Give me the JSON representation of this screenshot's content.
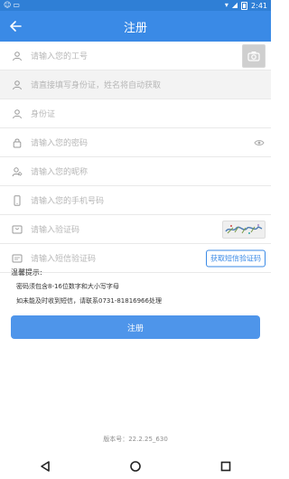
{
  "status_bar": {
    "time": "2:41",
    "left_icons": [
      "android-icon",
      "notification-icon"
    ],
    "right_icons": [
      "wifi-icon",
      "signal-icon",
      "battery-icon"
    ]
  },
  "header": {
    "title": "注册"
  },
  "form": {
    "employee_id_placeholder": "请输入您的工号",
    "id_card_hint": "请直接填写身份证，姓名将自动获取",
    "id_card_label": "身份证",
    "password_placeholder": "请输入您的密码",
    "nickname_placeholder": "请输入您的昵称",
    "phone_placeholder": "请输入您的手机号码",
    "captcha_placeholder": "请输入验证码",
    "sms_code_placeholder": "请输入短信验证码",
    "sms_button_label": "获取短信验证码"
  },
  "tips": {
    "title": "温馨提示:",
    "line1": "密码须包含8-16位数字和大小写字母",
    "line2": "如未能及时收到短信，请联系0731-81816966处理"
  },
  "submit": {
    "label": "注册"
  },
  "footer": {
    "version_text": "版本号：22.2.25_630"
  },
  "colors": {
    "brand_blue": "#3a8ae6",
    "button_blue": "#4e95ea",
    "status_bar_blue": "#2f7fd6",
    "placeholder_gray": "#b7b7b7"
  }
}
